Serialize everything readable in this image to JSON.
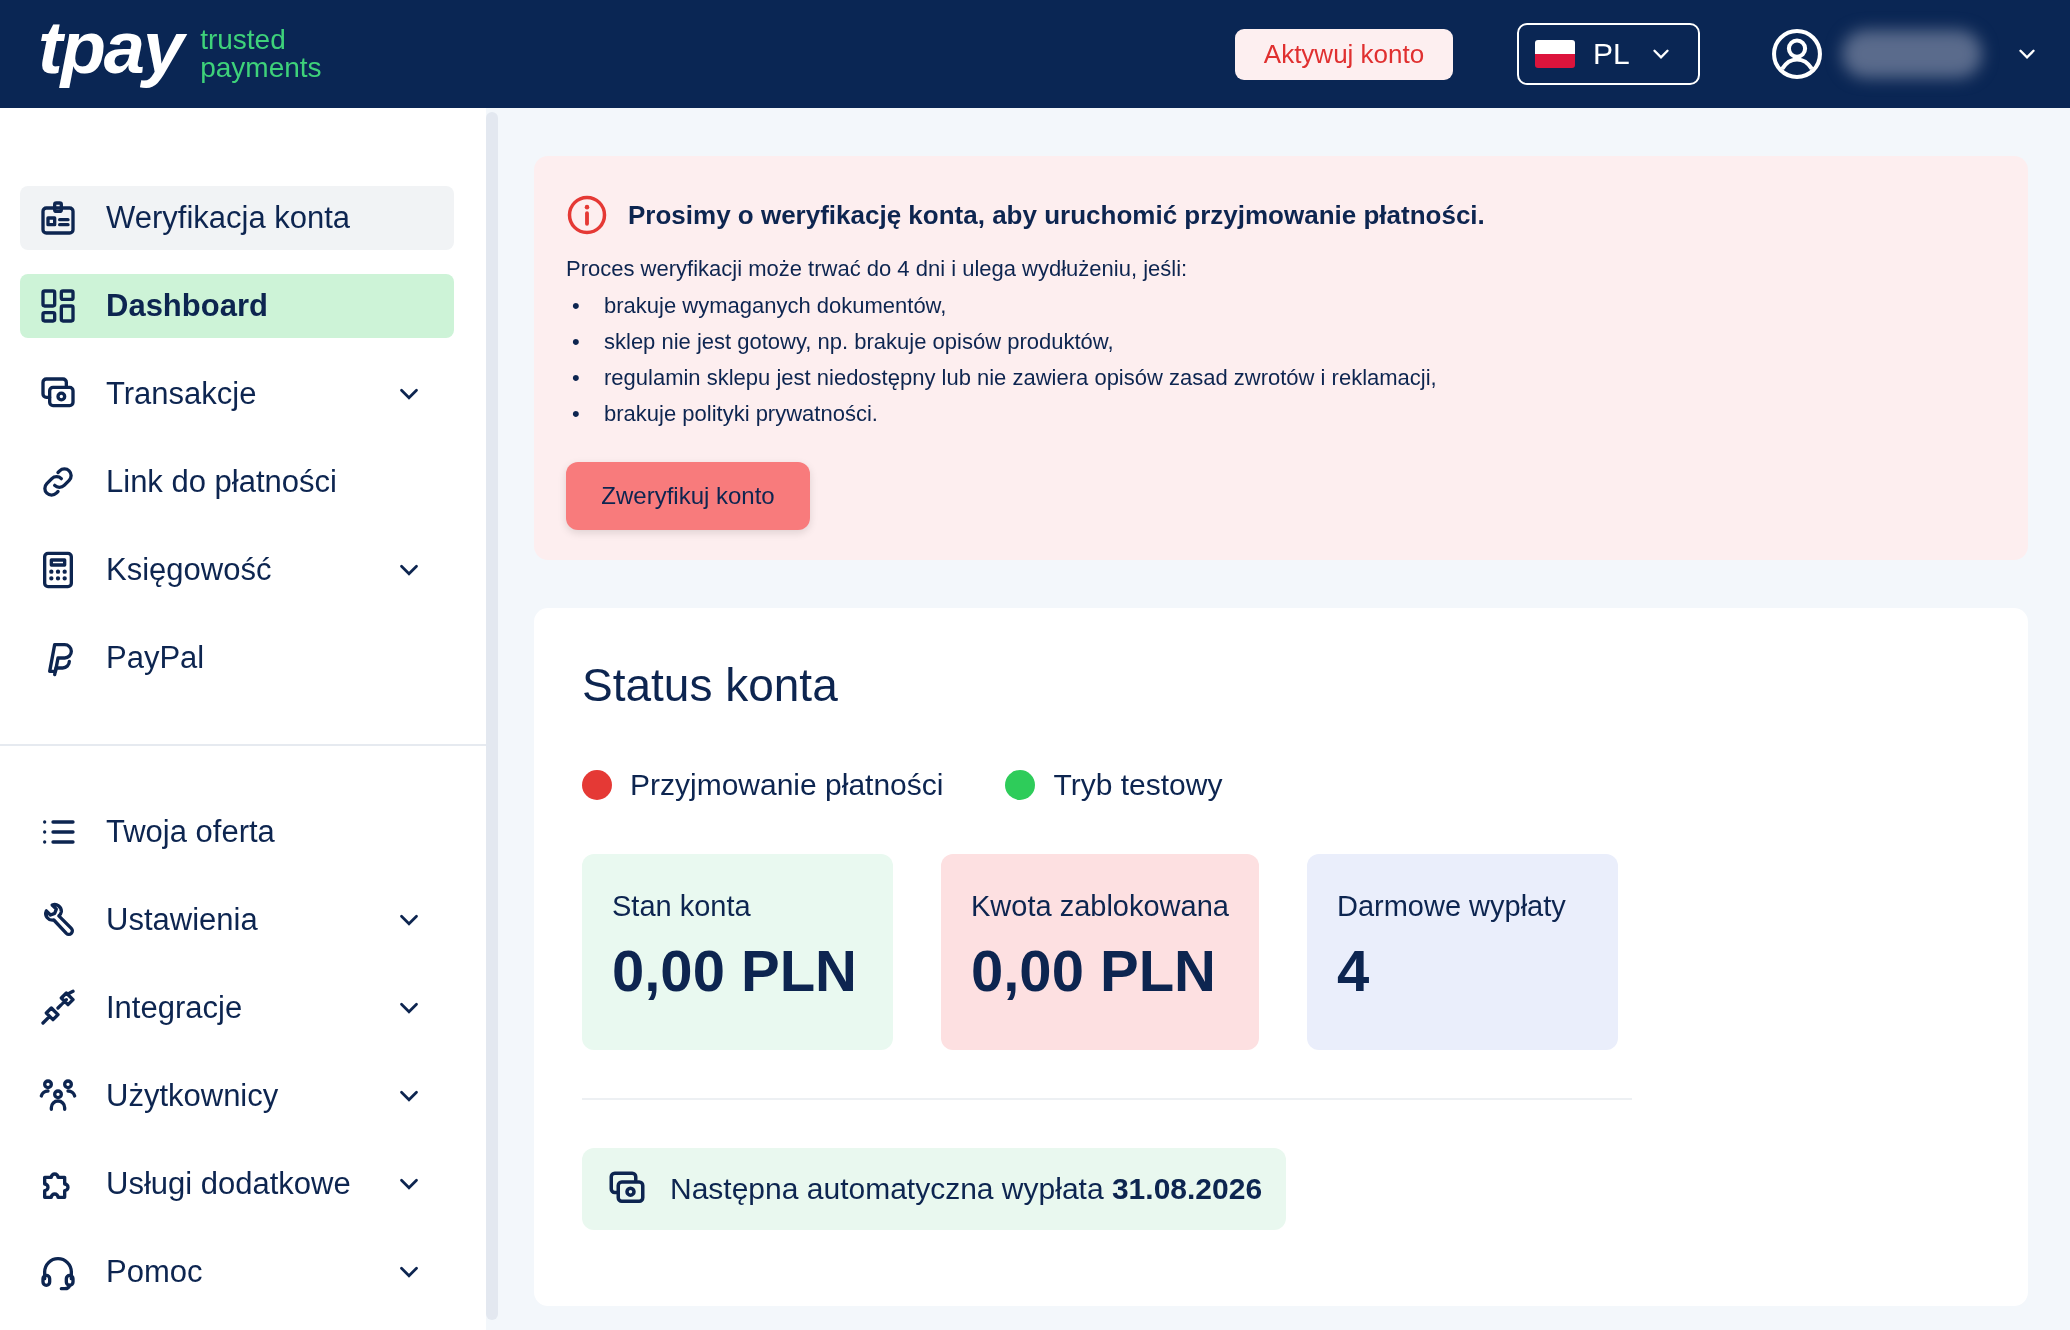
{
  "header": {
    "logo": "tpay",
    "tagline": [
      "trusted",
      "payments"
    ],
    "activate_button": "Aktywuj konto",
    "language": "PL"
  },
  "sidebar": {
    "sections": [
      {
        "items": [
          {
            "label": "Weryfikacja konta",
            "selected": false,
            "highlighted": true,
            "expandable": false
          },
          {
            "label": "Dashboard",
            "selected": true,
            "highlighted": false,
            "expandable": false
          },
          {
            "label": "Transakcje",
            "selected": false,
            "highlighted": false,
            "expandable": true
          },
          {
            "label": "Link do płatności",
            "selected": false,
            "highlighted": false,
            "expandable": false
          },
          {
            "label": "Księgowość",
            "selected": false,
            "highlighted": false,
            "expandable": true
          },
          {
            "label": "PayPal",
            "selected": false,
            "highlighted": false,
            "expandable": false
          }
        ]
      },
      {
        "items": [
          {
            "label": "Twoja oferta",
            "selected": false,
            "highlighted": false,
            "expandable": false
          },
          {
            "label": "Ustawienia",
            "selected": false,
            "highlighted": false,
            "expandable": true
          },
          {
            "label": "Integracje",
            "selected": false,
            "highlighted": false,
            "expandable": true
          },
          {
            "label": "Użytkownicy",
            "selected": false,
            "highlighted": false,
            "expandable": true
          },
          {
            "label": "Usługi dodatkowe",
            "selected": false,
            "highlighted": false,
            "expandable": true
          },
          {
            "label": "Pomoc",
            "selected": false,
            "highlighted": false,
            "expandable": true
          }
        ]
      }
    ]
  },
  "alert": {
    "title": "Prosimy o weryfikację konta, aby uruchomić przyjmowanie płatności.",
    "intro": "Proces weryfikacji może trwać do 4 dni i ulega wydłużeniu, jeśli:",
    "bullets": [
      {
        "marker": "•",
        "text": "brakuje wymaganych dokumentów,"
      },
      {
        "marker": "•",
        "text": "sklep nie jest gotowy, np. brakuje opisów produktów,"
      },
      {
        "marker": "•",
        "text": "regulamin sklepu jest niedostępny lub nie zawiera opisów zasad zwrotów i reklamacji,"
      },
      {
        "marker": "•",
        "text": "brakuje polityki prywatności."
      }
    ],
    "button": "Zweryfikuj konto"
  },
  "status": {
    "title": "Status konta",
    "indicators": [
      {
        "label": "Przyjmowanie płatności",
        "color": "#e53935"
      },
      {
        "label": "Tryb testowy",
        "color": "#2ecc5a"
      }
    ],
    "tiles": [
      {
        "label": "Stan konta",
        "value": "0,00 PLN",
        "color": "#e9f9f0"
      },
      {
        "label": "Kwota zablokowana",
        "value": "0,00 PLN",
        "color": "#fde0e1"
      },
      {
        "label": "Darmowe wypłaty",
        "value": "4",
        "color": "#eaeefb"
      }
    ],
    "next_payout": "Następna automatyczna wypłata **31.08.2026**"
  }
}
